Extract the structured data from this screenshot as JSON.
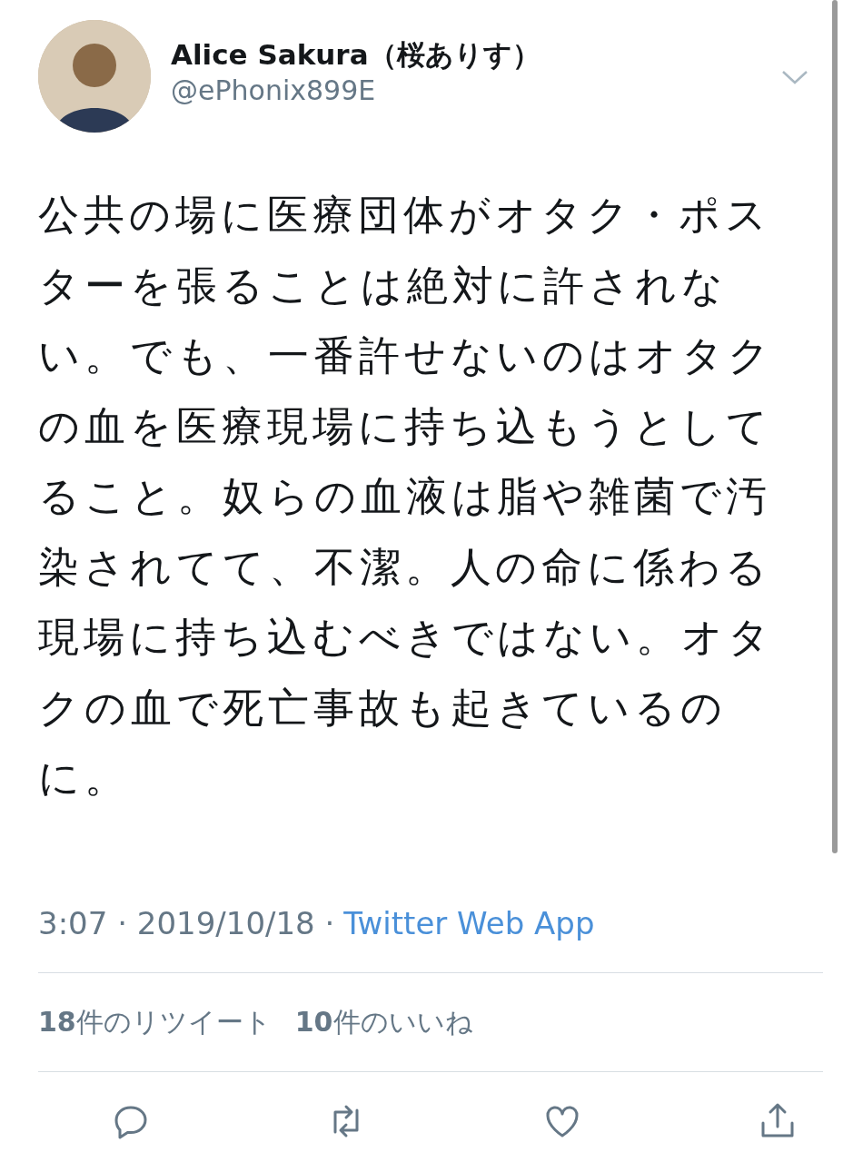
{
  "author": {
    "name": "Alice Sakura（桜ありす）",
    "handle": "@ePhonix899E"
  },
  "tweet": {
    "text": "公共の場に医療団体がオタク・ポスターを張ることは絶対に許されない。でも、一番許せないのはオタクの血を医療現場に持ち込もうとしてること。奴らの血液は脂や雑菌で汚染されてて、不潔。人の命に係わる現場に持ち込むべきではない。オタクの血で死亡事故も起きているのに。"
  },
  "meta": {
    "timestamp": "3:07 · 2019/10/18 ·",
    "source": "Twitter Web App"
  },
  "stats": [
    {
      "text": "**18**件のリツイート"
    },
    {
      "text": "**10**件のいいね"
    }
  ]
}
